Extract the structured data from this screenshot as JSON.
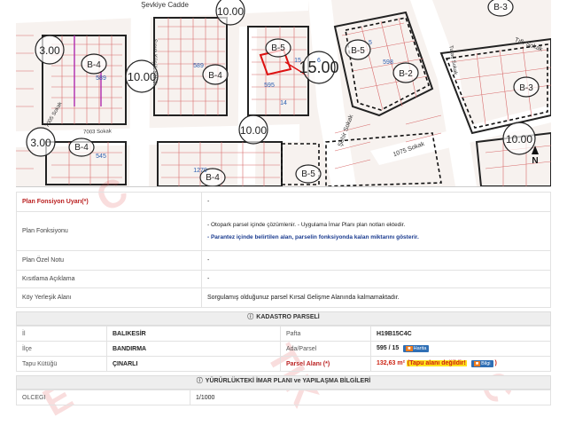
{
  "map": {
    "road_labels": [
      "Şevkiye Cadde",
      "Sınırlı Küçük Sokak",
      "7003 Sokak",
      "7005 Sokak",
      "Şehir Sokak",
      "1075 Sokak",
      "Tıflı Sokak",
      "Turaç Sokak"
    ],
    "zones": [
      "B-4",
      "B-4",
      "B-4",
      "B-5",
      "B-5",
      "B-4",
      "B-3",
      "B-3",
      "B-2",
      "B-3",
      "B-4",
      "B-5"
    ],
    "heights": [
      "10.00",
      "3.00",
      "10.00",
      "15.00",
      "10.00",
      "3.00",
      "10.00"
    ],
    "parcel_numbers": [
      "589",
      "589",
      "595",
      "598",
      "5",
      "6",
      "15",
      "14",
      "1270",
      "545"
    ],
    "north": "N"
  },
  "info_rows": [
    {
      "label": "Plan Fonsiyon Uyarı(*)",
      "value": "-",
      "red": true
    },
    {
      "label": "Plan Fonksiyonu",
      "value": "",
      "red": false
    },
    {
      "label": "Plan Özel Notu",
      "value": "-",
      "red": false
    },
    {
      "label": "Kısıtlama Açıklama",
      "value": "-",
      "red": false
    },
    {
      "label": "Köy Yerleşik Alanı",
      "value": "Sorgulamış olduğunuz parsel Kırsal Gelişme Alanında kalmamaktadır.",
      "red": false
    }
  ],
  "plan_function_lines": {
    "line1": "- Otopark parsel içinde çözümlenir. - Uygulama İmar Planı plan notları ektedir.",
    "line2": "- Parantez içinde belirtilen alan, parselin fonksiyonda kalan miktarını gösterir."
  },
  "kadastro": {
    "title": "KADASTRO PARSELİ",
    "il_label": "İl",
    "il": "BALIKESİR",
    "pafta_label": "Pafta",
    "pafta": "H19B15C4C",
    "ilce_label": "İlçe",
    "ilce": "BANDIRMA",
    "ada_label": "Ada/Parsel",
    "ada": "595 / 15",
    "harita_btn": "Harita",
    "tapu_label": "Tapu Kütüğü",
    "tapu": "ÇINARLI",
    "alan_label": "Parsel Alanı (*)",
    "alan": "132,63 m²",
    "alan_warn": "(Tapu alanı değildir!",
    "bilgi_btn": "Bilgi",
    "alan_close": ")"
  },
  "imar": {
    "title": "YÜRÜRLÜKTEKİ İMAR PLANI ve YAPILAŞMA BİLGİLERİ",
    "olcek_label": "OLCEGI",
    "olcek": "1/1000"
  },
  "colors": {
    "red": "#c21a1a",
    "accent": "#2f6fb5"
  }
}
